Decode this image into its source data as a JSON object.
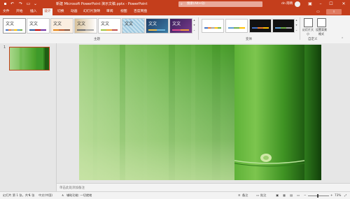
{
  "titlebar": {
    "title": "新建 Microsoft PowerPoint 演示文稿.pptx  -  PowerPoint",
    "search_placeholder": "搜索(Alt+Q)",
    "user": "dn 雨晴"
  },
  "tabs": [
    {
      "label": "文件"
    },
    {
      "label": "开始"
    },
    {
      "label": "插入"
    },
    {
      "label": "设计"
    },
    {
      "label": "切换"
    },
    {
      "label": "动画"
    },
    {
      "label": "幻灯片放映"
    },
    {
      "label": "审阅"
    },
    {
      "label": "视图"
    },
    {
      "label": "百度网盘"
    }
  ],
  "ribbon": {
    "themes_label": "主题",
    "variants_label": "变体",
    "customize_label": "自定义",
    "slide_size_label": "幻灯片大小",
    "format_bg_label": "设置背景格式",
    "theme_text": "文文"
  },
  "slide_panel": {
    "slide_number": "1"
  },
  "notes": {
    "placeholder": "单击此处添加备注"
  },
  "statusbar": {
    "slide_info": "幻灯片 第 1 张，共 1 张",
    "language": "中文(中国)",
    "accessibility": "辅助功能: 一切就绪",
    "notes_btn": "备注",
    "comments_btn": "批注",
    "zoom": "73%"
  }
}
